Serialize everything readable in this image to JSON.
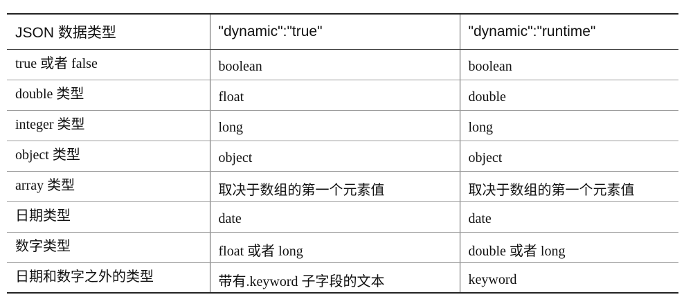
{
  "table": {
    "headers": [
      "JSON 数据类型",
      "\"dynamic\":\"true\"",
      "\"dynamic\":\"runtime\""
    ],
    "rows": [
      [
        "true 或者 false",
        "boolean",
        "boolean"
      ],
      [
        "double 类型",
        "float",
        "double"
      ],
      [
        "integer 类型",
        "long",
        "long"
      ],
      [
        "object 类型",
        "object",
        "object"
      ],
      [
        "array 类型",
        "取决于数组的第一个元素值",
        "取决于数组的第一个元素值"
      ],
      [
        "日期类型",
        "date",
        "date"
      ],
      [
        "数字类型",
        "float 或者 long",
        "double 或者 long"
      ],
      [
        "日期和数字之外的类型",
        "带有.keyword 子字段的文本",
        "keyword"
      ]
    ]
  }
}
